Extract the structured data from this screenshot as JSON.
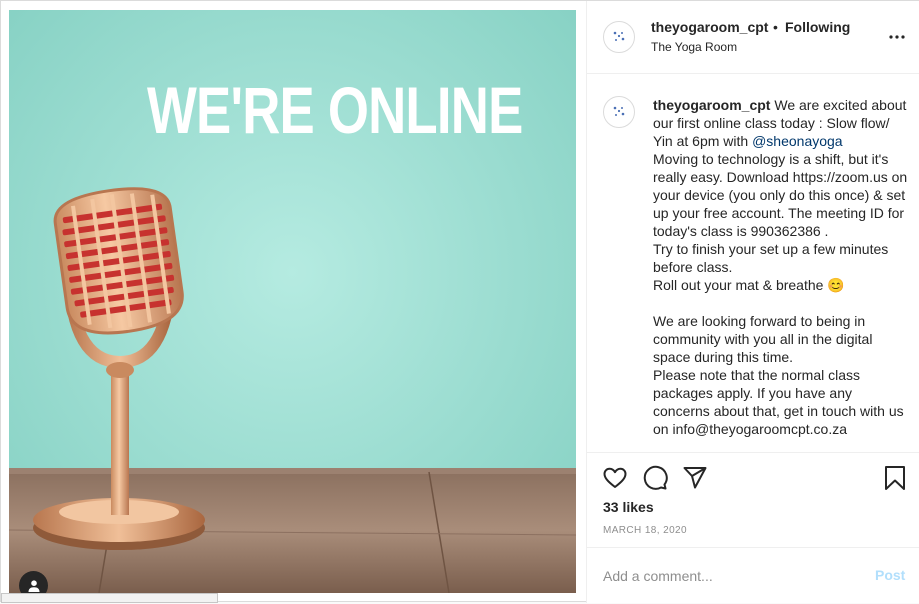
{
  "media": {
    "headline": "WE'RE ONLINE"
  },
  "header": {
    "username": "theyogaroom_cpt",
    "separator": "•",
    "follow_status": "Following",
    "location": "The Yoga Room"
  },
  "caption": {
    "username": "theyogaroom_cpt",
    "intro": " We are excited about our first online class today : Slow flow/ Yin at 6pm with ",
    "mention": "@sheonayoga",
    "lines": [
      "Moving to technology is a shift, but it's really easy. Download https://zoom.us on your device (you only do this once) & set up your free account. The meeting ID for today's class is 990362386 .",
      "Try to finish your set up a few minutes before class.",
      "Roll out your mat & breathe 😊",
      "",
      "We are looking forward to being in community with you all in the digital space during this time.",
      "Please note that the normal class packages apply. If you have any concerns about that, get in touch with us on info@theyogaroomcpt.co.za"
    ]
  },
  "stats": {
    "likes": "33 likes",
    "date": "MARCH 18, 2020"
  },
  "comment": {
    "placeholder": "Add a comment...",
    "post_label": "Post"
  },
  "icons": {
    "like": "heart-icon",
    "comment": "speech-bubble-icon",
    "share": "paper-plane-icon",
    "save": "bookmark-icon",
    "more": "ellipsis-icon",
    "user_tag": "person-icon"
  },
  "colors": {
    "background_teal": "#9fe0d3",
    "link": "#00376b",
    "post_button_disabled": "#b2dffc",
    "muted": "#8e8e8e"
  }
}
